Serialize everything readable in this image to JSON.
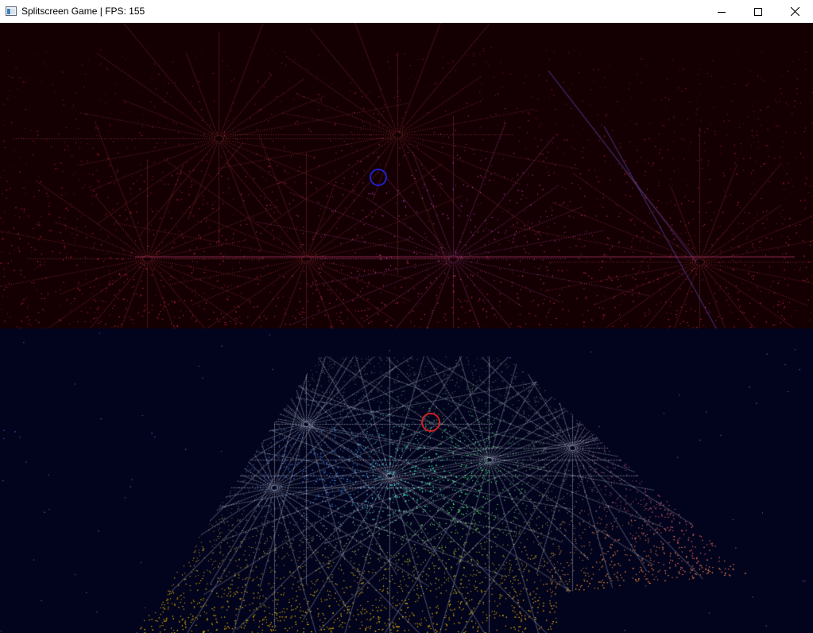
{
  "window": {
    "title": "Splitscreen Game | FPS: 155",
    "icon": "app-window-icon",
    "controls": [
      "minimize-icon",
      "maximize-icon",
      "close-icon"
    ]
  },
  "players": [
    {
      "view": "top",
      "background": "#140003",
      "marker_color": "#2020c8"
    },
    {
      "view": "bottom",
      "background": "#02031c",
      "marker_color": "#d02020"
    }
  ]
}
